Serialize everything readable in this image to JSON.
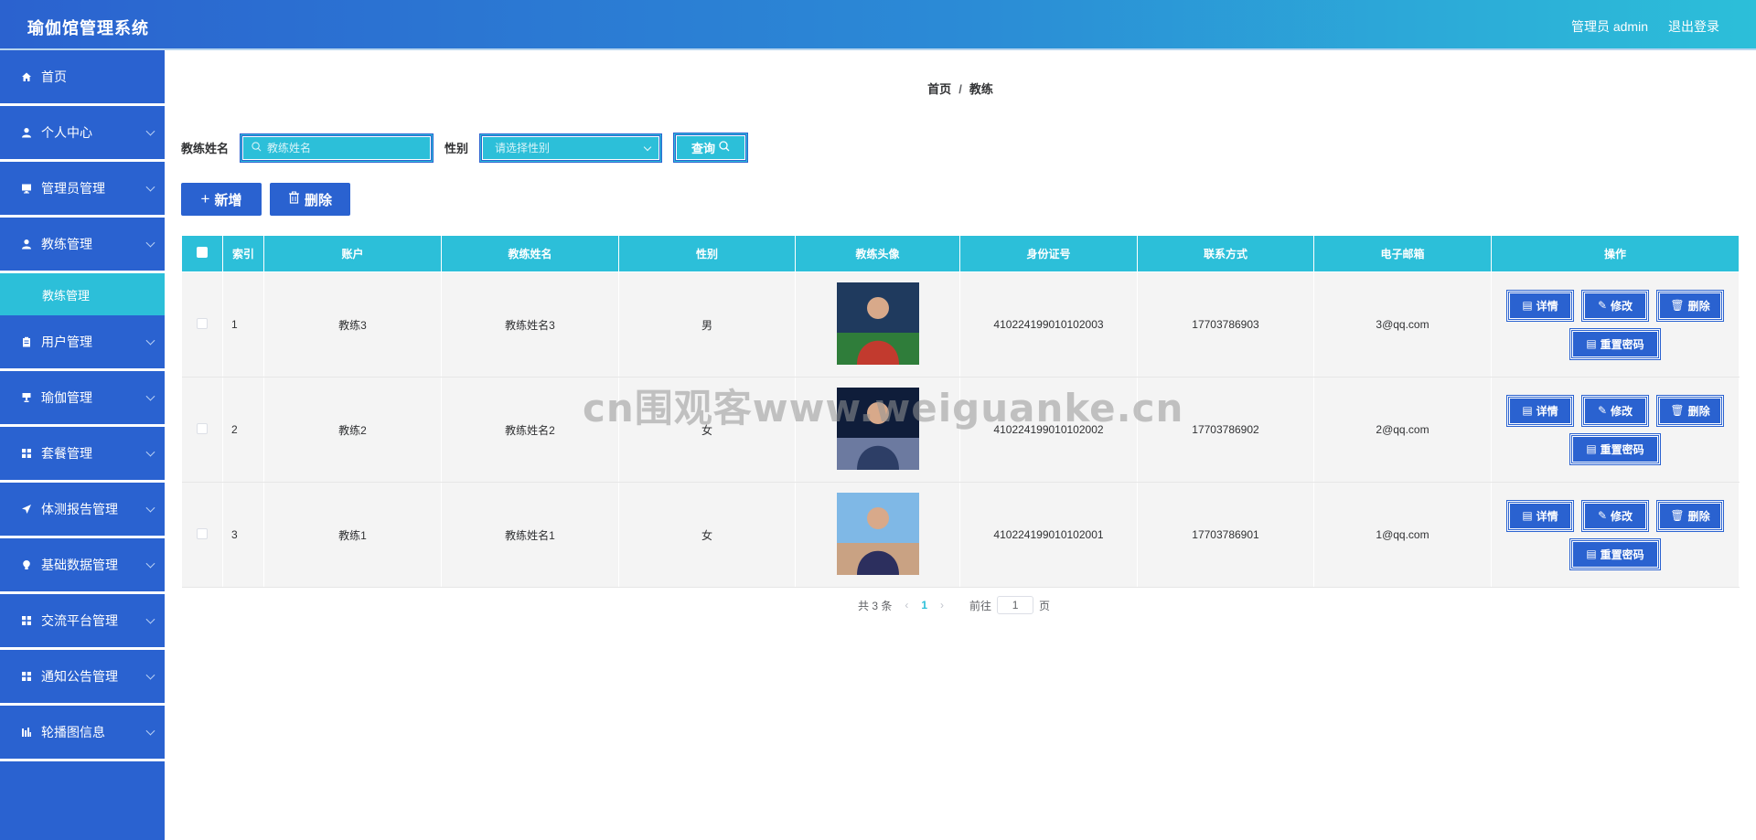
{
  "app": {
    "title": "瑜伽馆管理系统",
    "user_label": "管理员 admin",
    "logout_label": "退出登录"
  },
  "sidebar": {
    "items": [
      {
        "label": "首页",
        "icon": "home-icon",
        "has_children": false
      },
      {
        "label": "个人中心",
        "icon": "user-icon",
        "has_children": true
      },
      {
        "label": "管理员管理",
        "icon": "monitor-icon",
        "has_children": true
      },
      {
        "label": "教练管理",
        "icon": "user-icon",
        "has_children": true,
        "expanded": true,
        "children": [
          "教练管理"
        ]
      },
      {
        "label": "用户管理",
        "icon": "clipboard-icon",
        "has_children": true
      },
      {
        "label": "瑜伽管理",
        "icon": "cup-icon",
        "has_children": true
      },
      {
        "label": "套餐管理",
        "icon": "grid-icon",
        "has_children": true
      },
      {
        "label": "体测报告管理",
        "icon": "send-icon",
        "has_children": true
      },
      {
        "label": "基础数据管理",
        "icon": "bulb-icon",
        "has_children": true
      },
      {
        "label": "交流平台管理",
        "icon": "grid-icon",
        "has_children": true
      },
      {
        "label": "通知公告管理",
        "icon": "grid-icon",
        "has_children": true
      },
      {
        "label": "轮播图信息",
        "icon": "chart-icon",
        "has_children": true
      }
    ]
  },
  "breadcrumb": {
    "home": "首页",
    "separator": "/",
    "current": "教练"
  },
  "search": {
    "name_label": "教练姓名",
    "name_placeholder": "教练姓名",
    "gender_label": "性别",
    "gender_placeholder": "请选择性别",
    "query_label": "查询"
  },
  "actions": {
    "add_label": "新增",
    "delete_label": "删除"
  },
  "table": {
    "headers": [
      "索引",
      "账户",
      "教练姓名",
      "性别",
      "教练头像",
      "身份证号",
      "联系方式",
      "电子邮箱",
      "操作"
    ],
    "rows": [
      {
        "index": "1",
        "account": "教练3",
        "name": "教练姓名3",
        "gender": "男",
        "id_card": "410224199010102003",
        "phone": "17703786903",
        "email": "3@qq.com",
        "avatar_colors": [
          "#1f3a5e",
          "#c23a2e",
          "#2f7d3a"
        ]
      },
      {
        "index": "2",
        "account": "教练2",
        "name": "教练姓名2",
        "gender": "女",
        "id_card": "410224199010102002",
        "phone": "17703786902",
        "email": "2@qq.com",
        "avatar_colors": [
          "#0f1d3a",
          "#2d3e66",
          "#6c7aa0"
        ]
      },
      {
        "index": "3",
        "account": "教练1",
        "name": "教练姓名1",
        "gender": "女",
        "id_card": "410224199010102001",
        "phone": "17703786901",
        "email": "1@qq.com",
        "avatar_colors": [
          "#7fb8e6",
          "#2c2f5e",
          "#c9a283"
        ]
      }
    ],
    "row_actions": {
      "detail": "详情",
      "edit": "修改",
      "delete": "删除",
      "reset_password": "重置密码"
    }
  },
  "pagination": {
    "total_text": "共 3 条",
    "current_page": "1",
    "goto_label": "前往",
    "goto_value": "1",
    "page_suffix": "页"
  },
  "watermark": "cn围观客www.weiguanke.cn",
  "colors": {
    "primary": "#2a62d0",
    "accent": "#2cbfd9",
    "row_bg": "#f4f4f4"
  }
}
